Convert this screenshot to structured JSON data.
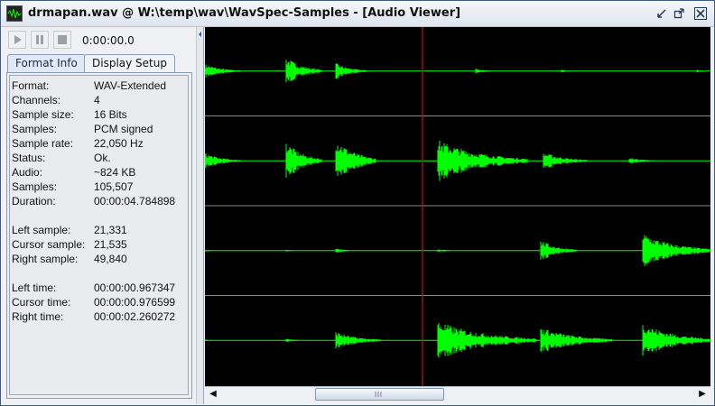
{
  "window": {
    "title": "drmapan.wav @ W:\\temp\\wav\\WavSpec-Samples - [Audio Viewer]"
  },
  "toolbar": {
    "time": "0:00:00.0"
  },
  "tabs": [
    {
      "label": "Format Info",
      "active": true
    },
    {
      "label": "Display Setup",
      "active": false
    }
  ],
  "format_info": [
    {
      "key": "Format:",
      "value": "WAV-Extended"
    },
    {
      "key": "Channels:",
      "value": "4"
    },
    {
      "key": "Sample size:",
      "value": "16 Bits"
    },
    {
      "key": "Samples:",
      "value": "PCM signed"
    },
    {
      "key": "Sample rate:",
      "value": "22,050 Hz"
    },
    {
      "key": "Status:",
      "value": "Ok."
    },
    {
      "key": "Audio:",
      "value": "~824 KB"
    },
    {
      "key": "Samples:",
      "value": "105,507"
    },
    {
      "key": "Duration:",
      "value": "00:00:04.784898"
    },
    {
      "key": "Left sample:",
      "value": "21,331"
    },
    {
      "key": "Cursor sample:",
      "value": "21,535"
    },
    {
      "key": "Right sample:",
      "value": "49,840"
    },
    {
      "key": "Left time:",
      "value": "00:00:00.967347"
    },
    {
      "key": "Cursor time:",
      "value": "00:00:00.976599"
    },
    {
      "key": "Right time:",
      "value": "00:00:02.260272"
    }
  ],
  "colors": {
    "waveform": "#00ff00",
    "cursor": "#c0141e",
    "background": "#000000"
  }
}
